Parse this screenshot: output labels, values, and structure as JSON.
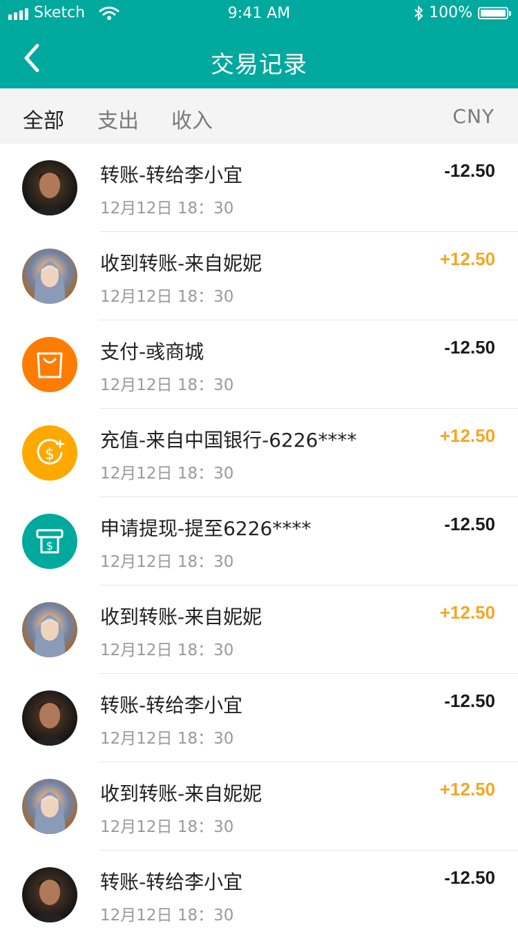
{
  "status_bar": {
    "carrier": "Sketch",
    "time": "9:41 AM",
    "battery": "100%"
  },
  "nav": {
    "title": "交易记录"
  },
  "tabs": [
    {
      "label": "全部",
      "active": true
    },
    {
      "label": "支出",
      "active": false
    },
    {
      "label": "收入",
      "active": false
    }
  ],
  "currency": "CNY",
  "colors": {
    "primary": "#00A99D",
    "income": "#F5A623",
    "expense": "#1a1a1a",
    "shop": "#FF7C00",
    "recharge": "#FFA800"
  },
  "transactions": [
    {
      "avatar": "male-avatar",
      "name": "转账-转给李小宜",
      "time": "12月12日 18：30",
      "amount": "-12.50",
      "type": "expense"
    },
    {
      "avatar": "female-avatar",
      "name": "收到转账-来自妮妮",
      "time": "12月12日 18：30",
      "amount": "+12.50",
      "type": "income"
    },
    {
      "avatar": "shopping-bag-icon",
      "name": "支付-彧商城",
      "time": "12月12日 18：30",
      "amount": "-12.50",
      "type": "expense"
    },
    {
      "avatar": "coin-plus-icon",
      "name": "充值-来自中国银行-6226****",
      "time": "12月12日 18：30",
      "amount": "+12.50",
      "type": "income"
    },
    {
      "avatar": "atm-withdraw-icon",
      "name": "申请提现-提至6226****",
      "time": "12月12日 18：30",
      "amount": "-12.50",
      "type": "expense"
    },
    {
      "avatar": "female-avatar",
      "name": "收到转账-来自妮妮",
      "time": "12月12日 18：30",
      "amount": "+12.50",
      "type": "income"
    },
    {
      "avatar": "male-avatar",
      "name": "转账-转给李小宜",
      "time": "12月12日 18：30",
      "amount": "-12.50",
      "type": "expense"
    },
    {
      "avatar": "female-avatar",
      "name": "收到转账-来自妮妮",
      "time": "12月12日 18：30",
      "amount": "+12.50",
      "type": "income"
    },
    {
      "avatar": "male-avatar",
      "name": "转账-转给李小宜",
      "time": "12月12日 18：30",
      "amount": "-12.50",
      "type": "expense"
    }
  ]
}
